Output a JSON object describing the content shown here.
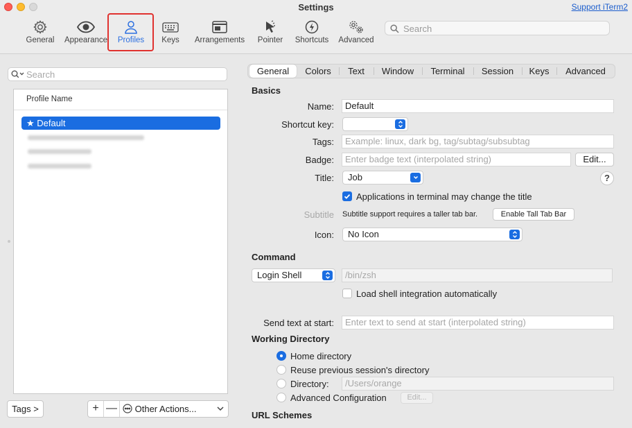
{
  "window": {
    "title": "Settings",
    "support_link": "Support iTerm2"
  },
  "toolbar": {
    "items": [
      {
        "label": "General",
        "icon": "gear-icon"
      },
      {
        "label": "Appearance",
        "icon": "eye-icon"
      },
      {
        "label": "Profiles",
        "icon": "person-icon",
        "selected": true
      },
      {
        "label": "Keys",
        "icon": "keyboard-icon"
      },
      {
        "label": "Arrangements",
        "icon": "window-icon"
      },
      {
        "label": "Pointer",
        "icon": "pointer-icon"
      },
      {
        "label": "Shortcuts",
        "icon": "bolt-icon"
      },
      {
        "label": "Advanced",
        "icon": "gears-icon"
      }
    ],
    "search_placeholder": "Search"
  },
  "left": {
    "search_placeholder": "Search",
    "column_header": "Profile Name",
    "profiles": [
      {
        "name": "Default",
        "selected": true,
        "favorite": true
      }
    ],
    "tags_button": "Tags >",
    "add_button": "+",
    "remove_button": "—",
    "other_actions": "Other Actions..."
  },
  "tabs": [
    "General",
    "Colors",
    "Text",
    "Window",
    "Terminal",
    "Session",
    "Keys",
    "Advanced"
  ],
  "active_tab": "General",
  "basics": {
    "section": "Basics",
    "name_label": "Name:",
    "name_value": "Default",
    "shortcut_label": "Shortcut key:",
    "shortcut_value": "",
    "tags_label": "Tags:",
    "tags_placeholder": "Example: linux, dark bg, tag/subtag/subsubtag",
    "badge_label": "Badge:",
    "badge_placeholder": "Enter badge text (interpolated string)",
    "badge_edit": "Edit...",
    "title_label": "Title:",
    "title_value": "Job",
    "help": "?",
    "apps_change_title": "Applications in terminal may change the title",
    "apps_change_title_checked": true,
    "subtitle_label": "Subtitle",
    "subtitle_note": "Subtitle support requires a taller tab bar.",
    "enable_tall_tab_bar": "Enable Tall Tab Bar",
    "icon_label": "Icon:",
    "icon_value": "No Icon"
  },
  "command": {
    "section": "Command",
    "mode": "Login Shell",
    "path_placeholder": "/bin/zsh",
    "load_shell_integration": "Load shell integration automatically",
    "load_shell_integration_checked": false,
    "send_text_label": "Send text at start:",
    "send_text_placeholder": "Enter text to send at start (interpolated string)"
  },
  "working_directory": {
    "section": "Working Directory",
    "options": [
      {
        "label": "Home directory",
        "selected": true
      },
      {
        "label": "Reuse previous session's directory",
        "selected": false
      },
      {
        "label": "Directory:",
        "selected": false
      },
      {
        "label": "Advanced Configuration",
        "selected": false
      }
    ],
    "directory_placeholder": "/Users/orange",
    "advanced_edit": "Edit..."
  },
  "url_schemes": {
    "section": "URL Schemes"
  },
  "colors": {
    "accent": "#1a6de1",
    "highlight": "#e0322f",
    "link": "#1a5ccc"
  }
}
